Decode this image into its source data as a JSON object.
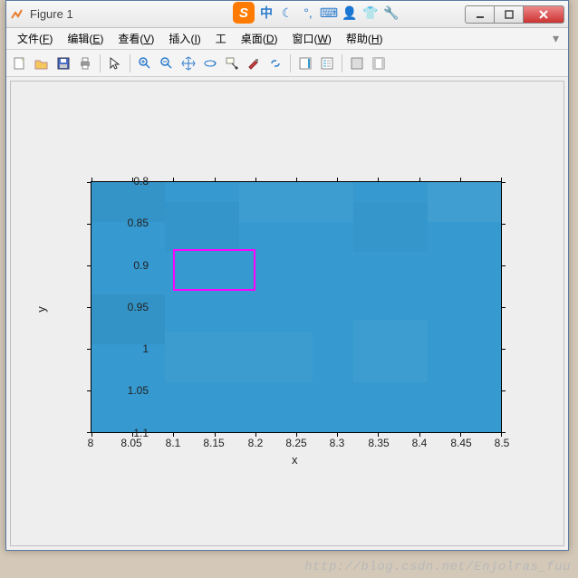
{
  "window": {
    "title": "Figure 1"
  },
  "menus": {
    "file": {
      "label": "文件",
      "hotkey": "F"
    },
    "edit": {
      "label": "编辑",
      "hotkey": "E"
    },
    "view": {
      "label": "查看",
      "hotkey": "V"
    },
    "insert": {
      "label": "插入",
      "hotkey": "I"
    },
    "tools": {
      "label": "工",
      "hotkey": ""
    },
    "desktop": {
      "label": "桌面",
      "hotkey": "D"
    },
    "window": {
      "label": "窗口",
      "hotkey": "W"
    },
    "help": {
      "label": "帮助",
      "hotkey": "H"
    }
  },
  "floatbar": {
    "badge": "S",
    "ime_label": "中"
  },
  "axes": {
    "xlabel": "x",
    "ylabel": "y",
    "xticks": [
      "8",
      "8.05",
      "8.1",
      "8.15",
      "8.2",
      "8.25",
      "8.3",
      "8.35",
      "8.4",
      "8.45",
      "8.5"
    ],
    "yticks": [
      "0.8",
      "0.85",
      "0.9",
      "0.95",
      "1",
      "1.05",
      "1.1"
    ]
  },
  "chart_data": {
    "type": "heatmap",
    "title": "",
    "xlabel": "x",
    "ylabel": "y",
    "xlim": [
      8.0,
      8.5
    ],
    "ylim_display": [
      0.8,
      1.1
    ],
    "y_reversed": true,
    "highlight_rect": {
      "x0": 8.1,
      "x1": 8.2,
      "y0": 0.88,
      "y1": 0.93,
      "color": "#ff00ff"
    },
    "note": "heatmap cells are near-uniform; values unreadable from image"
  },
  "watermark": "http://blog.csdn.net/Enjolras_fuu"
}
